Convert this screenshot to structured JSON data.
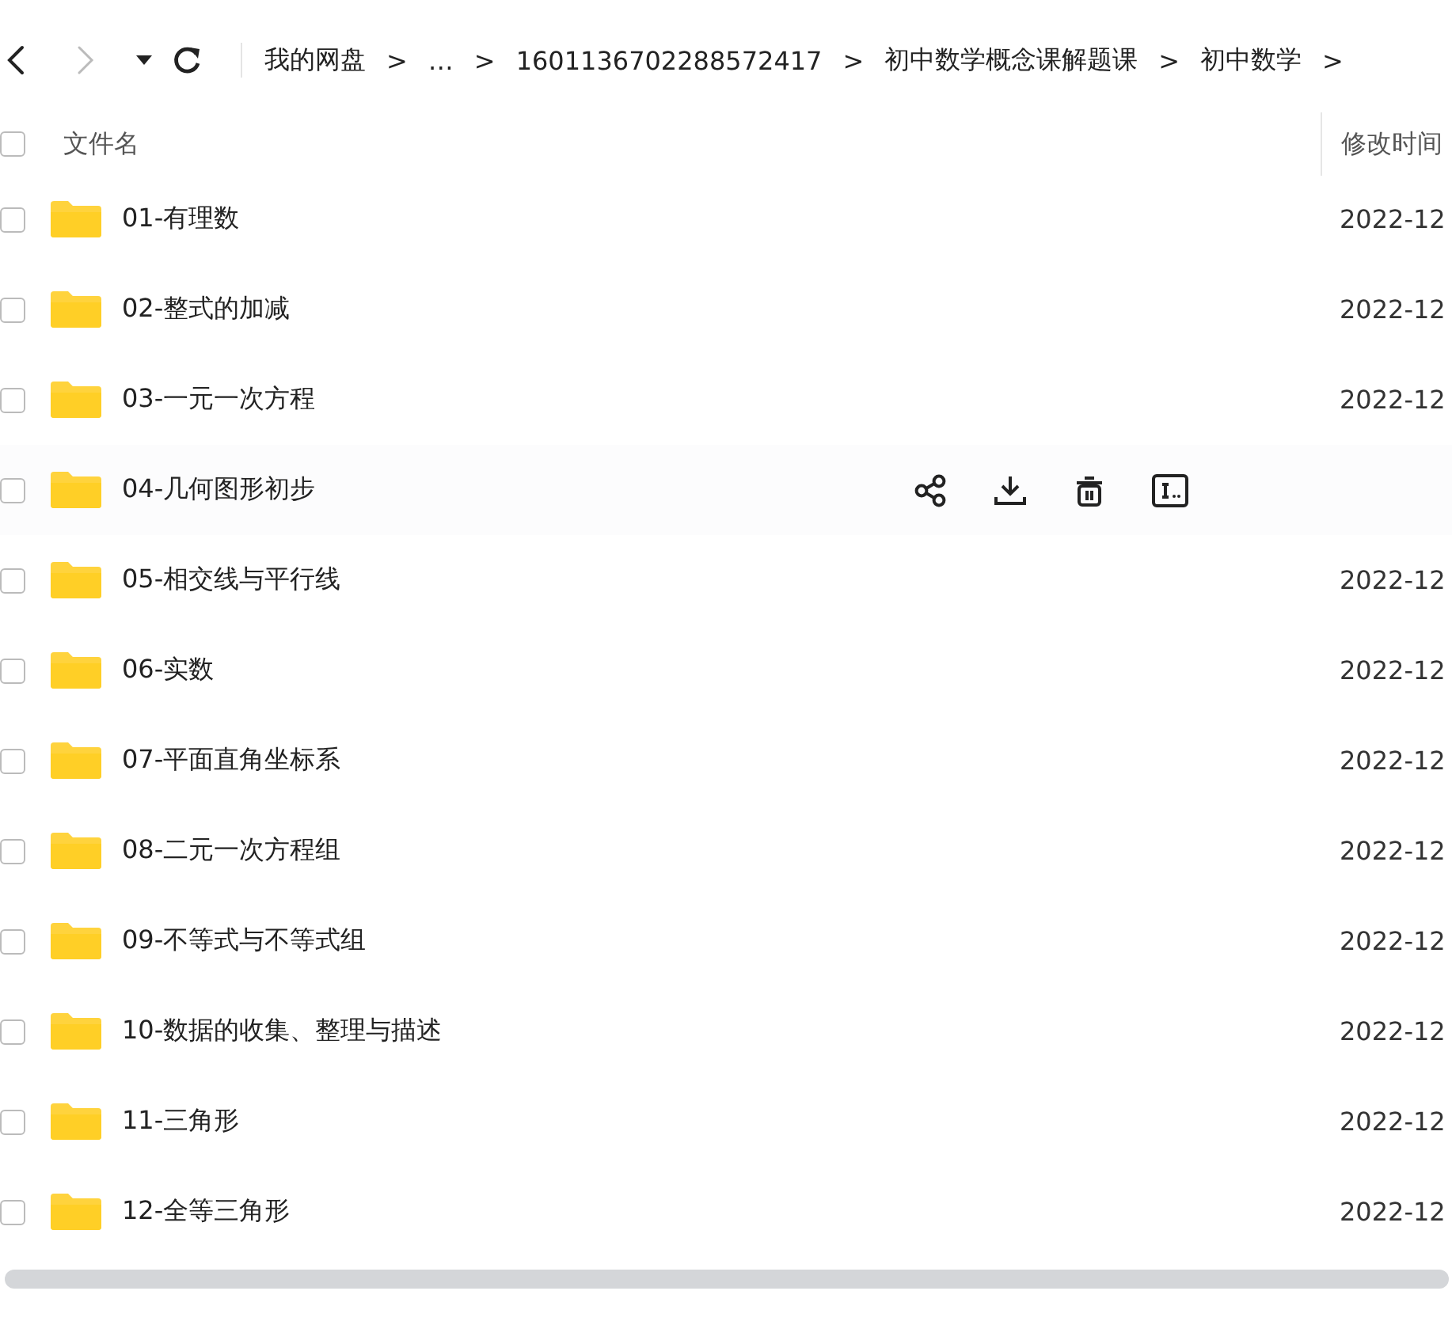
{
  "nav": {
    "back_disabled": false,
    "forward_disabled": true
  },
  "breadcrumb": [
    "我的网盘",
    "…",
    "1601136702288572417",
    "初中数学概念课解题课",
    "初中数学"
  ],
  "breadcrumb_separator": ">",
  "table": {
    "columns": [
      "文件名",
      "修改时间"
    ],
    "select_all": false,
    "rows": [
      {
        "name": "01-有理数",
        "modified": "2022-12",
        "checked": false,
        "hovered": false
      },
      {
        "name": "02-整式的加减",
        "modified": "2022-12",
        "checked": false,
        "hovered": false
      },
      {
        "name": "03-一元一次方程",
        "modified": "2022-12",
        "checked": false,
        "hovered": false
      },
      {
        "name": "04-几何图形初步",
        "checked": false,
        "hovered": true
      },
      {
        "name": "05-相交线与平行线",
        "modified": "2022-12",
        "checked": false,
        "hovered": false
      },
      {
        "name": "06-实数",
        "modified": "2022-12",
        "checked": false,
        "hovered": false
      },
      {
        "name": "07-平面直角坐标系",
        "modified": "2022-12",
        "checked": false,
        "hovered": false
      },
      {
        "name": "08-二元一次方程组",
        "modified": "2022-12",
        "checked": false,
        "hovered": false
      },
      {
        "name": "09-不等式与不等式组",
        "modified": "2022-12",
        "checked": false,
        "hovered": false
      },
      {
        "name": "10-数据的收集、整理与描述",
        "modified": "2022-12",
        "checked": false,
        "hovered": false
      },
      {
        "name": "11-三角形",
        "modified": "2022-12",
        "checked": false,
        "hovered": false
      },
      {
        "name": "12-全等三角形",
        "modified": "2022-12",
        "checked": false,
        "hovered": false
      }
    ]
  }
}
